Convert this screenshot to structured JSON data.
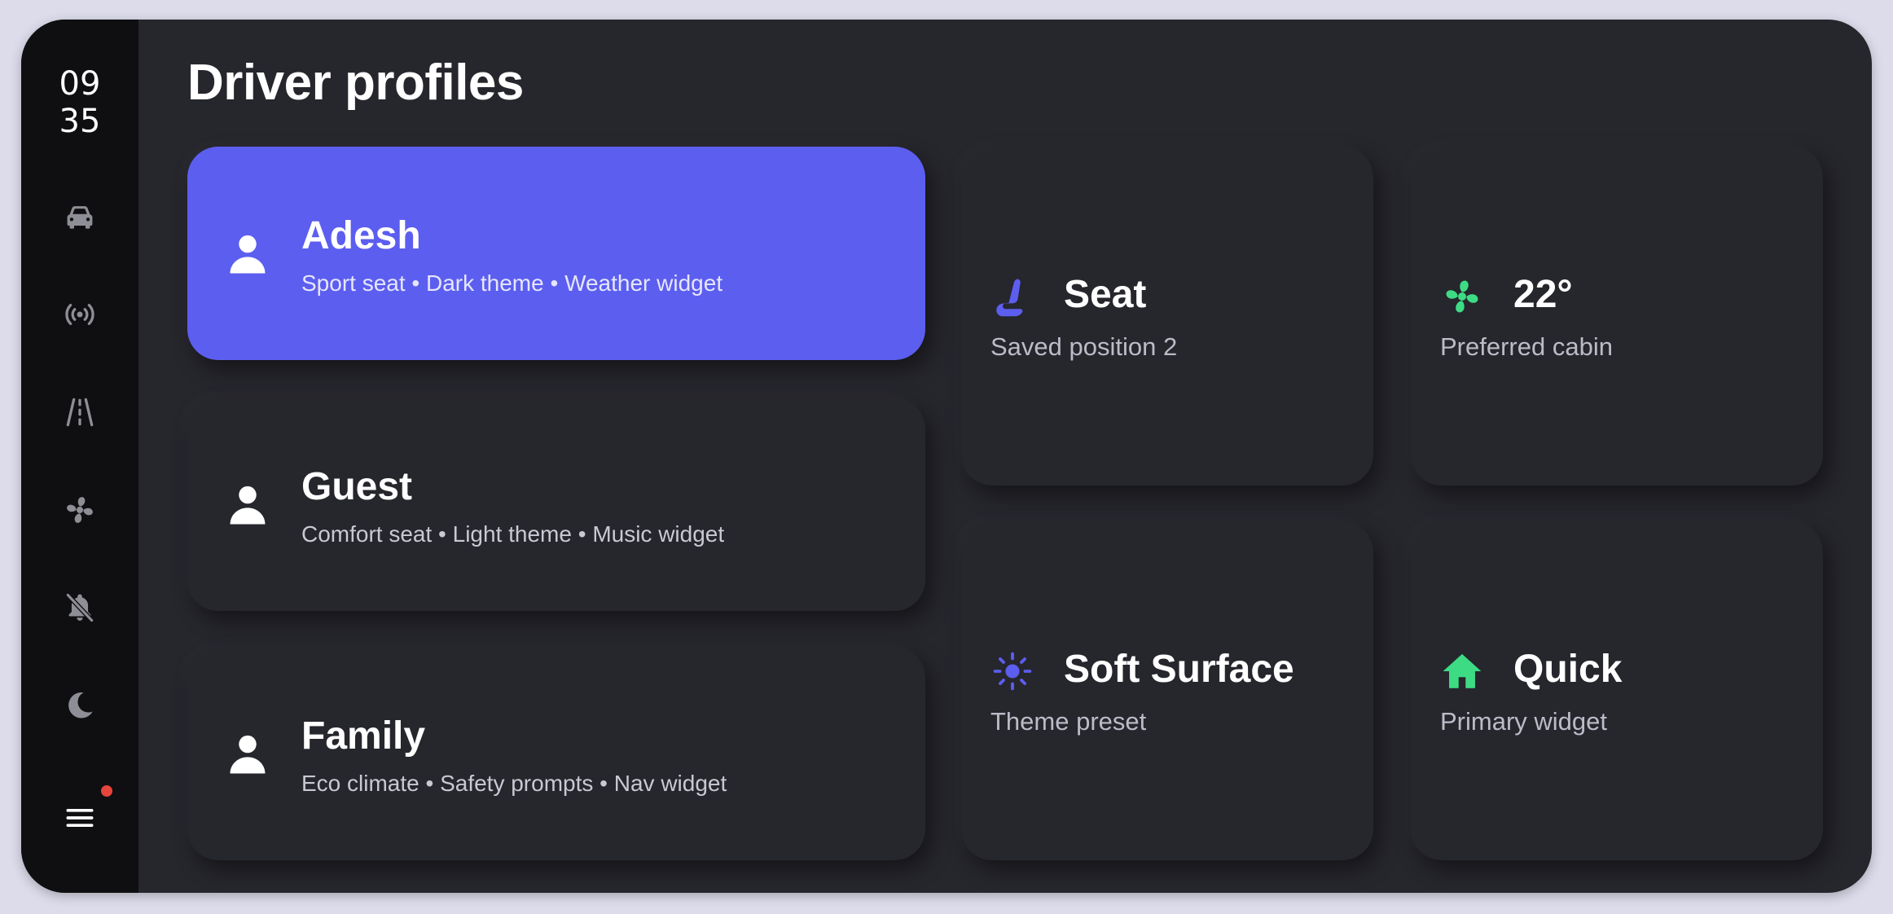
{
  "clock": {
    "hour": "09",
    "minute": "35"
  },
  "rail": {
    "icons": [
      "car-icon",
      "signal-icon",
      "road-icon",
      "fan-icon",
      "bell-off-icon",
      "moon-icon",
      "menu-icon"
    ],
    "notification_color": "#e5453a"
  },
  "page": {
    "title": "Driver profiles"
  },
  "profiles": [
    {
      "name": "Adesh",
      "description": "Sport seat • Dark theme • Weather widget",
      "active": true,
      "icon": "user-icon"
    },
    {
      "name": "Guest",
      "description": "Comfort seat • Light theme • Music widget",
      "active": false,
      "icon": "user-icon"
    },
    {
      "name": "Family",
      "description": "Eco climate • Safety prompts • Nav widget",
      "active": false,
      "icon": "user-icon"
    }
  ],
  "tiles": [
    {
      "title": "Seat",
      "subtitle": "Saved position 2",
      "icon": "seat-icon",
      "icon_color": "#5c5ef0"
    },
    {
      "title": "22°",
      "subtitle": "Preferred cabin",
      "icon": "fan-icon",
      "icon_color": "#3ddc84"
    },
    {
      "title": "Soft Surface",
      "subtitle": "Theme preset",
      "icon": "sun-icon",
      "icon_color": "#5c5ef0"
    },
    {
      "title": "Quick",
      "subtitle": "Primary widget",
      "icon": "home-icon",
      "icon_color": "#3ddc84"
    }
  ],
  "colors": {
    "accent": "#5c5ef0",
    "green": "#3ddc84",
    "panel": "#26262d",
    "rail": "#0f0f12",
    "backdrop": "#dcdceb"
  }
}
